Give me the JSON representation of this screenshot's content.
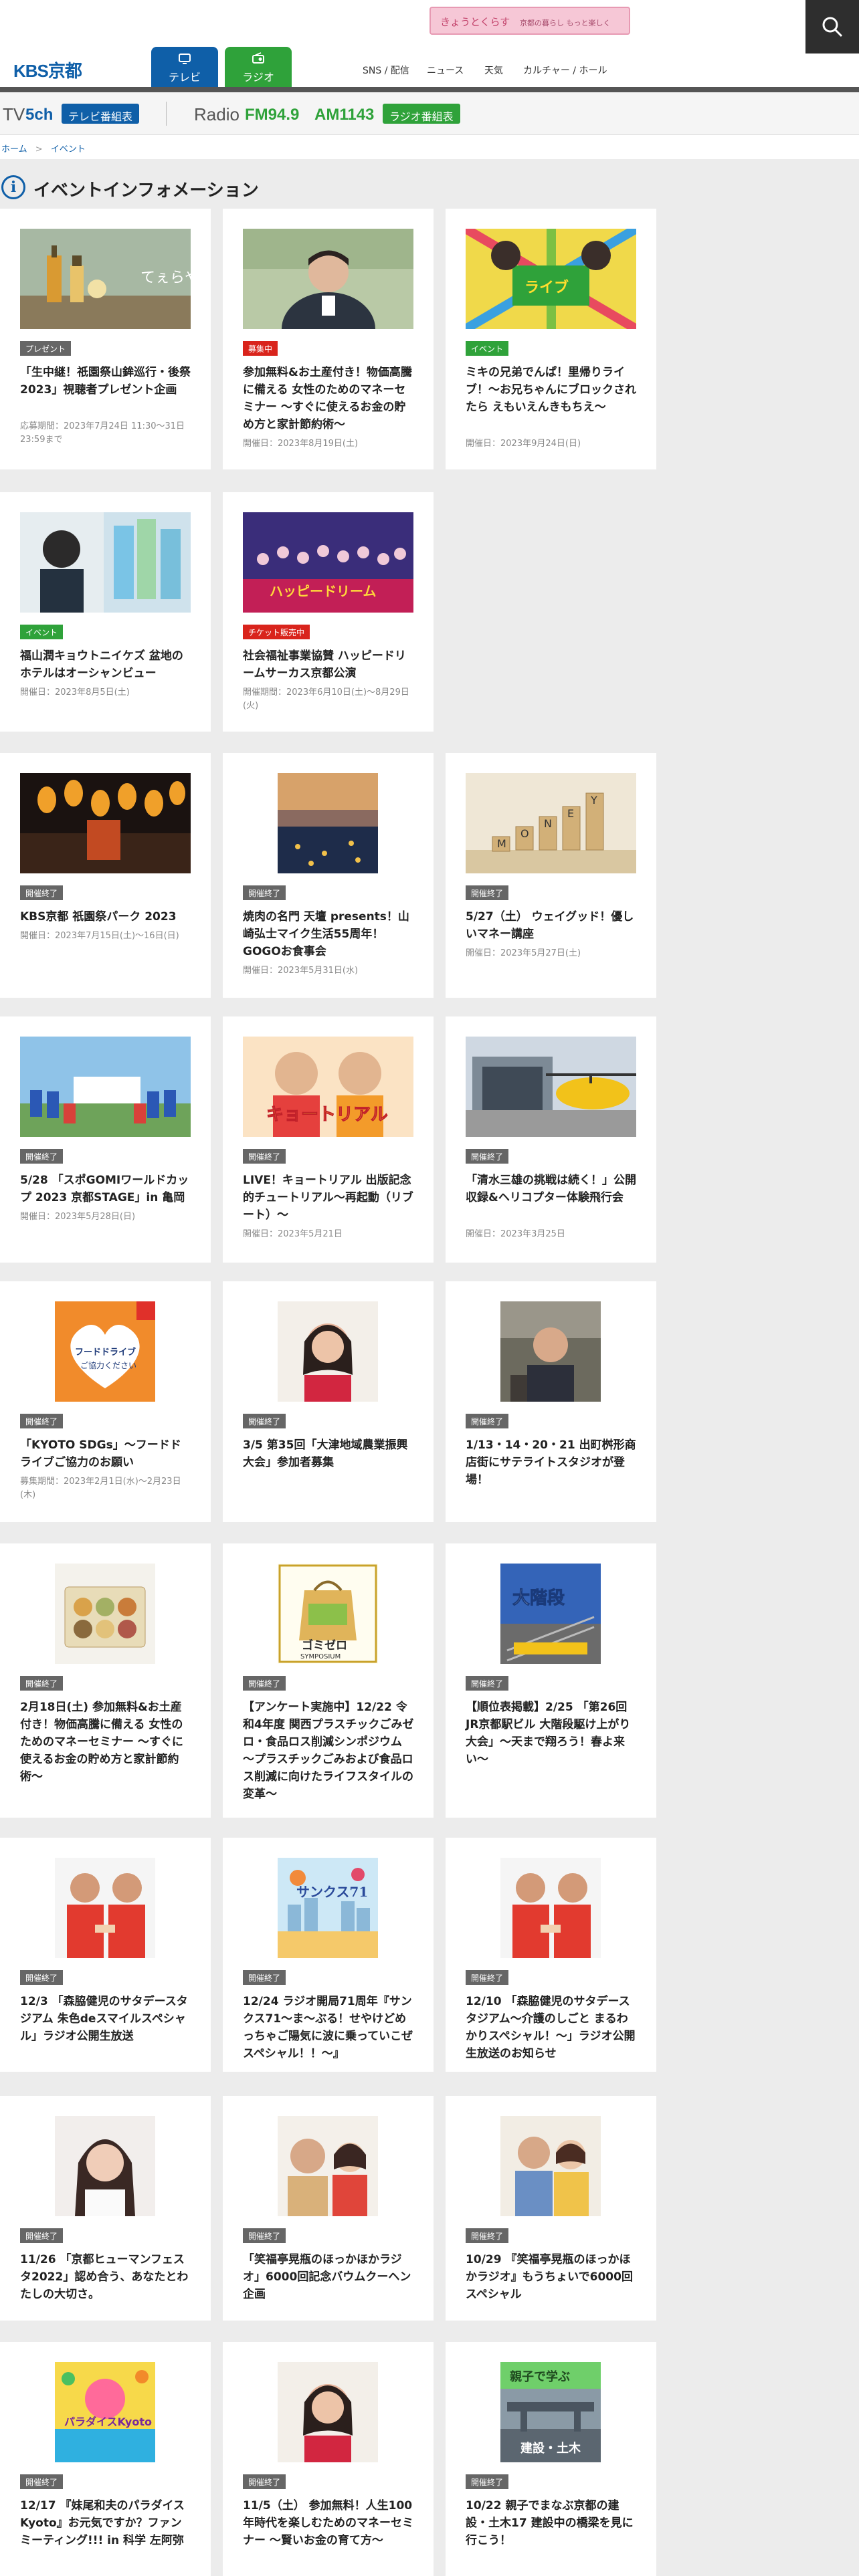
{
  "header": {
    "logo": "KBS京都",
    "tabs": [
      {
        "label": "テレビ",
        "icon": "tv-icon"
      },
      {
        "label": "ラジオ",
        "icon": "radio-icon"
      }
    ],
    "promo": {
      "label": "きょうとくらす",
      "sub": "京都の暮らし もっと楽しく"
    },
    "nav": [
      "SNS / 配信",
      "ニュース",
      "天気",
      "カルチャー / ホール"
    ],
    "search_icon": "search-icon"
  },
  "schedule": {
    "tv_label": "TV",
    "tv_channel": "5ch",
    "tv_button": "テレビ番組表",
    "radio_label": "Radio",
    "fm": "FM94.9",
    "am": "AM1143",
    "radio_button": "ラジオ番組表"
  },
  "breadcrumb": {
    "home": "ホーム",
    "current": "イベント"
  },
  "page_title": "イベントインフォメーション",
  "colors": {
    "brand_blue": "#0f5fa8",
    "brand_green": "#2fa23a",
    "badge_red": "#d9241c",
    "badge_gray": "#666666"
  },
  "cards": [
    {
      "badge": "プレゼント",
      "title": "「生中継！祇園祭山鉾巡行・後祭2023」視聴者プレゼント企画",
      "meta": "応募期間：2023年7月24日 11:30〜31日 23:59まで"
    },
    {
      "badge": "募集中",
      "title": "参加無料&お土産付き！物価高騰に備える 女性のためのマネーセミナー 〜すぐに使えるお金の貯め方と家計節約術〜",
      "meta": "開催日：2023年8月19日(土)"
    },
    {
      "badge": "イベント",
      "title": "ミキの兄弟でんぱ！里帰りライブ！〜お兄ちゃんにブロックされたら えもいえんきもちえ〜",
      "meta": "開催日：2023年9月24日(日)"
    },
    {
      "badge": "イベント",
      "title": "福山潤キョウトニイケズ 盆地のホテルはオーシャンビュー",
      "meta": "開催日：2023年8月5日(土)"
    },
    {
      "badge": "チケット販売中",
      "title": "社会福祉事業協賛 ハッピードリームサーカス京都公演",
      "meta": "開催期間：2023年6月10日(土)〜8月29日(火)"
    },
    {
      "badge": "開催終了",
      "title": "KBS京都 祇園祭パーク 2023",
      "meta": "開催日：2023年7月15日(土)〜16日(日)"
    },
    {
      "badge": "開催終了",
      "title": "焼肉の名門 天壇 presents！山崎弘士マイク生活55周年！GOGOお食事会",
      "meta": "開催日：2023年5月31日(水)"
    },
    {
      "badge": "開催終了",
      "title": "5/27（土） ウェイグッド！優しいマネー講座",
      "meta": "開催日：2023年5月27日(土)"
    },
    {
      "badge": "開催終了",
      "title": "5/28 「スポGOMIワールドカップ 2023 京都STAGE」in 亀岡",
      "meta": "開催日：2023年5月28日(日)"
    },
    {
      "badge": "開催終了",
      "title": "LIVE！キョートリアル 出版記念的チュートリアル〜再起動（リブート）〜",
      "meta": "開催日：2023年5月21日"
    },
    {
      "badge": "開催終了",
      "title": "「清水三雄の挑戦は続く！」公開収録&ヘリコプター体験飛行会",
      "meta": "開催日：2023年3月25日"
    },
    {
      "badge": "開催終了",
      "title": "「KYOTO SDGs」〜フードドライブご協力のお願い",
      "meta": "募集期間：2023年2月1日(水)〜2月23日(木)"
    },
    {
      "badge": "開催終了",
      "title": "3/5 第35回「大津地域農業振興大会」参加者募集",
      "meta": ""
    },
    {
      "badge": "開催終了",
      "title": "1/13・14・20・21 出町桝形商店街にサテライトスタジオが登場！",
      "meta": ""
    },
    {
      "badge": "開催終了",
      "title": "2月18日(土) 参加無料&お土産付き！物価高騰に備える 女性のためのマネーセミナー 〜すぐに使えるお金の貯め方と家計節約術〜",
      "meta": ""
    },
    {
      "badge": "開催終了",
      "title": "【アンケート実施中】12/22 令和4年度 関西プラスチックごみゼロ・食品ロス削減シンポジウム 〜プラスチックごみおよび食品ロス削減に向けたライフスタイルの変革〜",
      "meta": ""
    },
    {
      "badge": "開催終了",
      "title": "【順位表掲載】2/25 「第26回 JR京都駅ビル 大階段駆け上がり大会」〜天まで翔ろう！春よ来い〜",
      "meta": ""
    },
    {
      "badge": "開催終了",
      "title": "12/3 「森脇健児のサタデースタジアム 朱色deスマイルスペシャル」ラジオ公開生放送",
      "meta": ""
    },
    {
      "badge": "開催終了",
      "title": "12/24 ラジオ開局71周年『サンクス71〜ま〜ぶる！せやけどめっちゃご陽気に波に乗っていこぜスペシャル！！〜』",
      "meta": ""
    },
    {
      "badge": "開催終了",
      "title": "12/10 「森脇健児のサタデースタジアム〜介護のしごと まるわかりスペシャル！〜」ラジオ公開生放送のお知らせ",
      "meta": ""
    },
    {
      "badge": "開催終了",
      "title": "11/26 「京都ヒューマンフェスタ2022」認め合う、あなたとわたしの大切さ。",
      "meta": ""
    },
    {
      "badge": "開催終了",
      "title": "「笑福亭晃瓶のほっかほかラジオ」6000回記念バウムクーヘン企画",
      "meta": ""
    },
    {
      "badge": "開催終了",
      "title": "10/29 『笑福亭晃瓶のほっかほかラジオ』もうちょいで6000回スペシャル",
      "meta": ""
    },
    {
      "badge": "開催終了",
      "title": "12/17 『妹尾和夫のパラダイスKyoto』お元気ですか？ファンミーティング!!! in 科学 左阿弥",
      "meta": ""
    },
    {
      "badge": "開催終了",
      "title": "11/5（土） 参加無料！人生100年時代を楽しむためのマネーセミナー 〜賢いお金の育て方〜",
      "meta": ""
    },
    {
      "badge": "開催終了",
      "title": "10/22 親子でまなぶ京都の建設・土木17 建設中の橋梁を見に行こう！",
      "meta": ""
    }
  ]
}
